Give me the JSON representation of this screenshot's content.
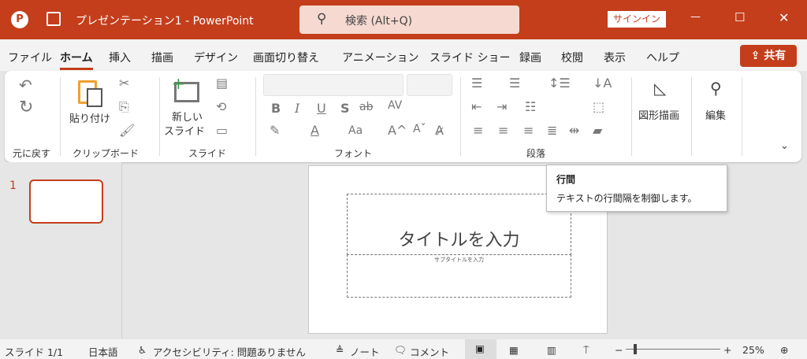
{
  "titlebar": {
    "doc_title": "プレゼンテーション1 - PowerPoint",
    "search_placeholder": "検索 (Alt+Q)",
    "signin": "サインイン",
    "minimize": "—",
    "maximize": "☐",
    "close": "✕"
  },
  "tabs": [
    "ファイル",
    "ホーム",
    "挿入",
    "描画",
    "デザイン",
    "画面切り替え",
    "アニメーション",
    "スライド ショー",
    "録画",
    "校閲",
    "表示",
    "ヘルプ"
  ],
  "active_tab": "ホーム",
  "share": "共有",
  "ribbon": {
    "undo_group": "元に戻す",
    "clipboard": {
      "label": "クリップボード",
      "paste": "貼り付け"
    },
    "slides": {
      "label": "スライド",
      "new_slide_1": "新しい",
      "new_slide_2": "スライド"
    },
    "font": {
      "label": "フォント",
      "bold": "B",
      "italic": "I",
      "underline": "U",
      "shadow": "S",
      "strike": "ab",
      "spacing": "AV",
      "case": "Aa",
      "grow": "A^",
      "shrink": "Aˇ"
    },
    "paragraph": {
      "label": "段落"
    },
    "drawing": {
      "label": "図形描画"
    },
    "editing": {
      "label": "編集"
    }
  },
  "thumbnail": {
    "number": "1"
  },
  "slide": {
    "title_placeholder": "タイトルを入力",
    "subtitle_placeholder": "サブタイトルを入力"
  },
  "tooltip": {
    "title": "行間",
    "body": "テキストの行間隔を制御します。"
  },
  "status": {
    "slide": "スライド 1/1",
    "language": "日本語",
    "accessibility": "アクセシビリティ: 問題ありません",
    "notes": "ノート",
    "comments": "コメント",
    "zoom": "25%"
  },
  "colors": {
    "brand": "#c43e1c"
  }
}
